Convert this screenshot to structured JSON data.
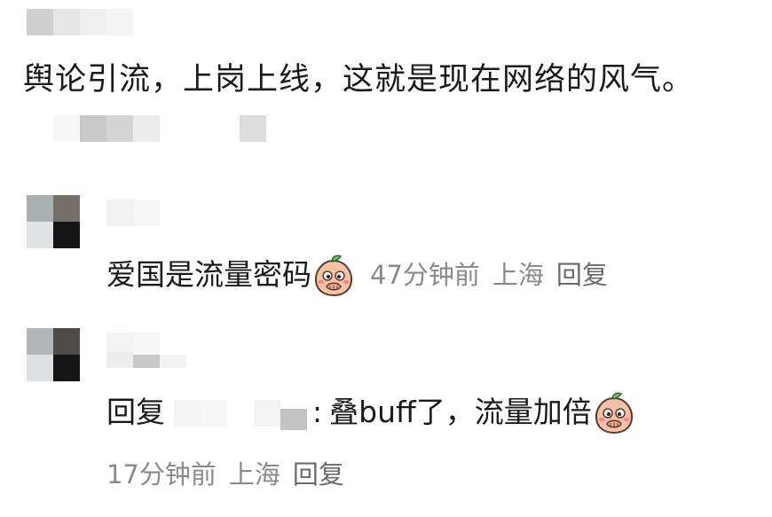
{
  "top_comment": {
    "text": "舆论引流，上岗上线，这就是现在网络的风气。"
  },
  "replies": [
    {
      "text": "爱国是流量密码",
      "emoji": "peach-covering-mouth-emoji",
      "time": "47分钟前",
      "location": "上海",
      "reply_label": "回复"
    },
    {
      "prefix": "回复",
      "separator": ":",
      "text": "叠buff了，流量加倍",
      "emoji": "peach-covering-mouth-emoji",
      "time": "17分钟前",
      "location": "上海",
      "reply_label": "回复"
    }
  ],
  "colors": {
    "text": "#1a1a1a",
    "meta": "#8a8a8a",
    "reply_link": "#6a6a6a",
    "emoji_body": "#f6c2a6",
    "emoji_leaf": "#6cc36c"
  }
}
